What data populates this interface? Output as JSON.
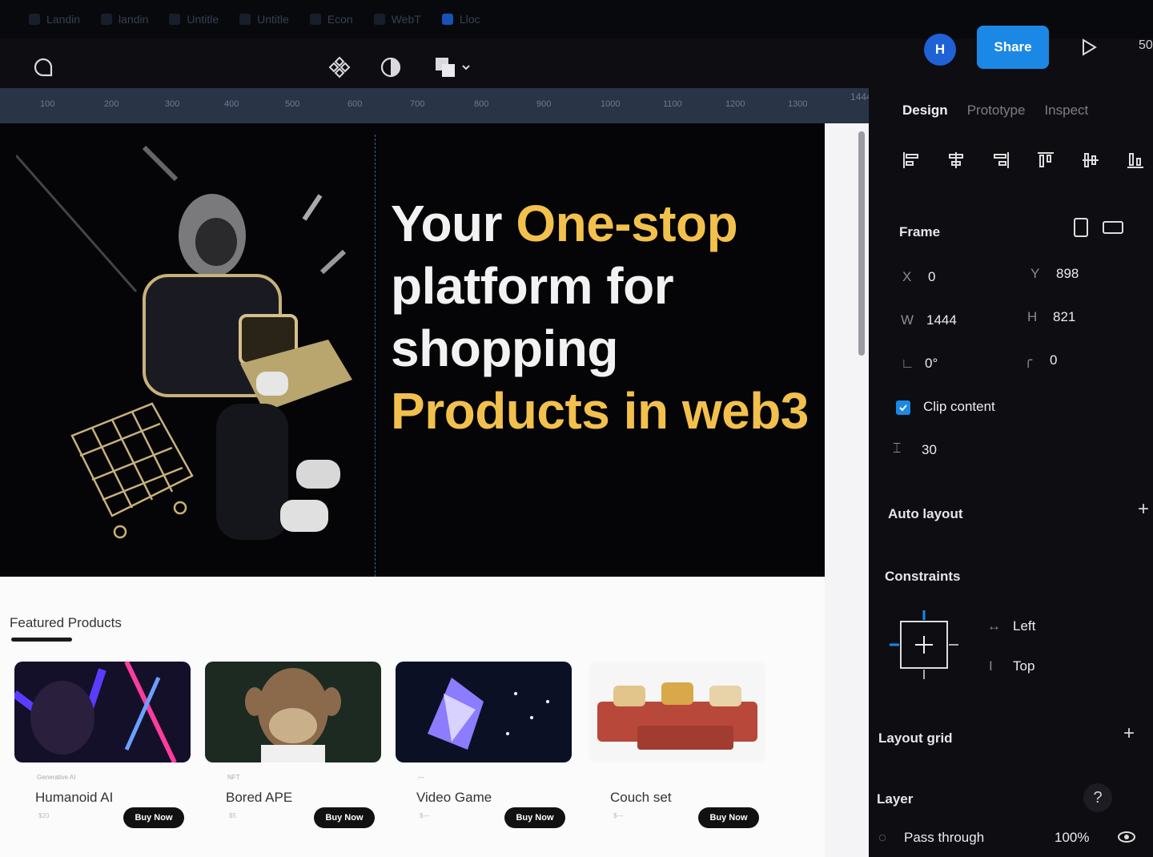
{
  "file_tabs": [
    "Landin",
    "landin",
    "Untitle",
    "Untitle",
    "Econ",
    "WebT",
    "Lloc"
  ],
  "header": {
    "avatar_initial": "H",
    "share_label": "Share",
    "zoom_label": "50"
  },
  "ruler": {
    "ticks": [
      "100",
      "200",
      "300",
      "400",
      "500",
      "600",
      "700",
      "800",
      "900",
      "1000",
      "1100",
      "1200",
      "1300"
    ],
    "end": "1444"
  },
  "hero": {
    "line1_white": "Your ",
    "line1_yellow": "One-stop",
    "line2": "platform for",
    "line3": "shopping",
    "line4": "Products in web3",
    "accent_color": "#f2c04c"
  },
  "featured": {
    "title": "Featured Products",
    "products": [
      {
        "name": "Humanoid AI",
        "sub": "Generative AI",
        "price": "$20",
        "button": "Buy Now"
      },
      {
        "name": "Bored APE",
        "sub": "NFT",
        "price": "$5",
        "button": "Buy Now"
      },
      {
        "name": "Video Game",
        "sub": "—",
        "price": "$—",
        "button": "Buy Now"
      },
      {
        "name": "Couch set",
        "sub": "",
        "price": "$—",
        "button": "Buy Now"
      }
    ]
  },
  "panel": {
    "tabs": [
      "Design",
      "Prototype",
      "Inspect"
    ],
    "frame_label": "Frame",
    "x_key": "X",
    "x_val": "0",
    "y_key": "Y",
    "y_val": "898",
    "w_key": "W",
    "w_val": "1444",
    "h_key": "H",
    "h_val": "821",
    "rotation": "0°",
    "radius": "0",
    "clip_content": "Clip content",
    "spacing": "30",
    "auto_layout": "Auto layout",
    "constraints": "Constraints",
    "constraint_h": "Left",
    "constraint_v": "Top",
    "layout_grid": "Layout grid",
    "layer": "Layer",
    "blend": "Pass through",
    "opacity": "100%",
    "help": "?"
  }
}
